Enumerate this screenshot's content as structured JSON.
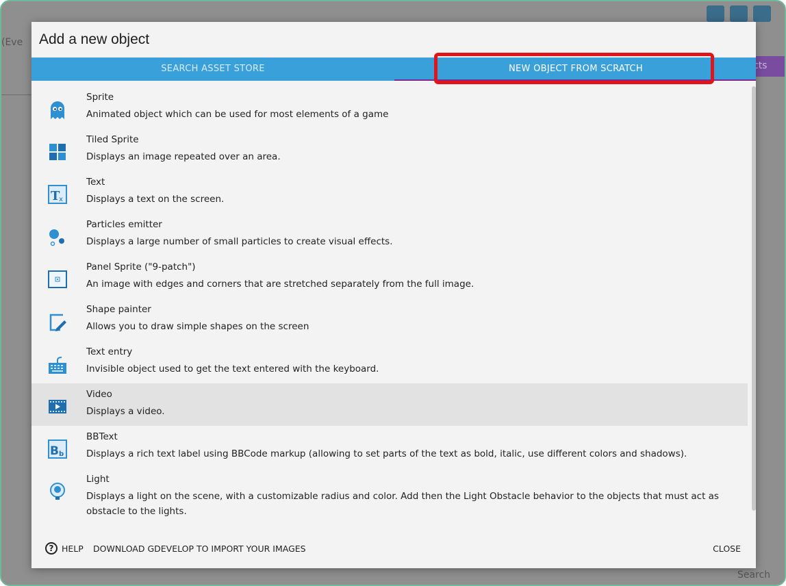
{
  "background": {
    "tab_partial": "(Eve",
    "objects_partial": "cts",
    "search_partial": "Search"
  },
  "dialog": {
    "title": "Add a new object",
    "tabs": {
      "search": "SEARCH ASSET STORE",
      "scratch": "NEW OBJECT FROM SCRATCH"
    },
    "items": [
      {
        "name": "Sprite",
        "desc": "Animated object which can be used for most elements of a game",
        "icon": "sprite-icon"
      },
      {
        "name": "Tiled Sprite",
        "desc": "Displays an image repeated over an area.",
        "icon": "tiled-sprite-icon"
      },
      {
        "name": "Text",
        "desc": "Displays a text on the screen.",
        "icon": "text-icon"
      },
      {
        "name": "Particles emitter",
        "desc": "Displays a large number of small particles to create visual effects.",
        "icon": "particles-icon"
      },
      {
        "name": "Panel Sprite (\"9-patch\")",
        "desc": "An image with edges and corners that are stretched separately from the full image.",
        "icon": "panel-sprite-icon"
      },
      {
        "name": "Shape painter",
        "desc": "Allows you to draw simple shapes on the screen",
        "icon": "shape-painter-icon"
      },
      {
        "name": "Text entry",
        "desc": "Invisible object used to get the text entered with the keyboard.",
        "icon": "keyboard-icon"
      },
      {
        "name": "Video",
        "desc": "Displays a video.",
        "icon": "video-icon"
      },
      {
        "name": "BBText",
        "desc": "Displays a rich text label using BBCode markup (allowing to set parts of the text as bold, italic, use different colors and shadows).",
        "icon": "bbtext-icon"
      },
      {
        "name": "Light",
        "desc": "Displays a light on the scene, with a customizable radius and color. Add then the Light Obstacle behavior to the objects that must act as obstacle to the lights.",
        "icon": "light-icon"
      }
    ],
    "footer": {
      "help": "HELP",
      "download": "DOWNLOAD GDEVELOP TO IMPORT YOUR IMAGES",
      "close": "CLOSE"
    }
  },
  "colors": {
    "tab_bar": "#3aa0d9",
    "tab_indicator": "#7b2a8f",
    "highlight": "#e0141b"
  }
}
